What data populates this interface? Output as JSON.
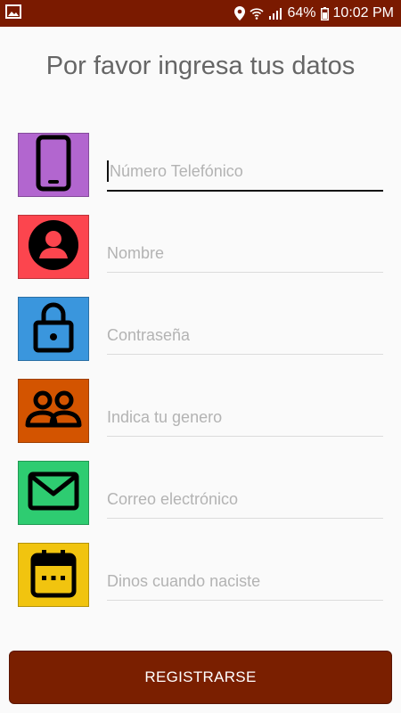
{
  "status_bar": {
    "battery": "64%",
    "time": "10:02 PM",
    "icons": [
      "image-icon",
      "location-icon",
      "wifi-icon",
      "signal-icon",
      "battery-icon"
    ]
  },
  "screen": {
    "title": "Por favor ingresa tus datos"
  },
  "form": {
    "fields": [
      {
        "placeholder": "Número Telefónico",
        "icon": "phone-icon",
        "color": "#b266cf",
        "active": true
      },
      {
        "placeholder": "Nombre",
        "icon": "person-icon",
        "color": "#fc454e"
      },
      {
        "placeholder": "Contraseña",
        "icon": "lock-icon",
        "color": "#3a96dd"
      },
      {
        "placeholder": "Indica tu genero",
        "icon": "people-icon",
        "color": "#d35400"
      },
      {
        "placeholder": "Correo electrónico",
        "icon": "mail-icon",
        "color": "#2ecc71"
      },
      {
        "placeholder": "Dinos cuando naciste",
        "icon": "calendar-icon",
        "color": "#f1c40f"
      }
    ],
    "submit_label": "REGISTRARSE"
  },
  "colors": {
    "status_bar": "#7a1a00",
    "button": "#7a1f00"
  }
}
